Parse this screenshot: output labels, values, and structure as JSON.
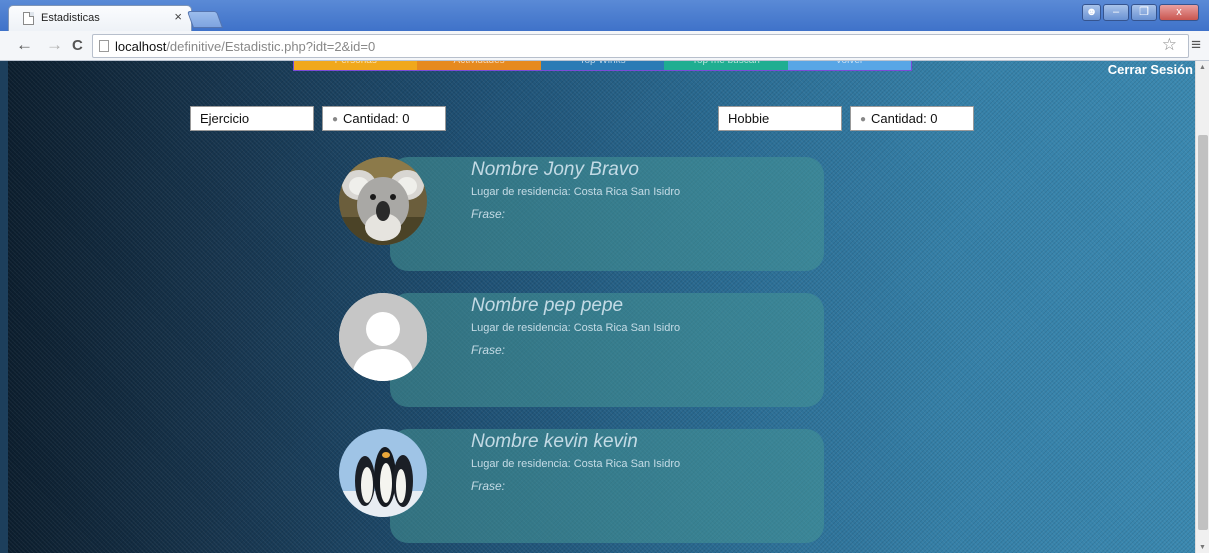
{
  "browser": {
    "tab_title": "Estadisticas",
    "tab_close": "×",
    "url_host": "localhost",
    "url_path": "/definitive/Estadistic.php?idt=2&id=0",
    "window_close": "x"
  },
  "nav": {
    "items": [
      "Personas",
      "Actividades",
      "Top Winks",
      "Top me buscan",
      "Volver"
    ],
    "logout": "Cerrar Sesión"
  },
  "stats": {
    "left_category": "Ejercicio",
    "left_count": "Cantidad: 0",
    "right_category": "Hobbie",
    "right_count": "Cantidad: 0"
  },
  "users": [
    {
      "name": "Nombre Jony Bravo",
      "residence": "Lugar de residencia: Costa Rica San Isidro",
      "phrase": "Frase:",
      "avatar": "koala"
    },
    {
      "name": "Nombre pep pepe",
      "residence": "Lugar de residencia: Costa Rica San Isidro",
      "phrase": "Frase:",
      "avatar": "default-user"
    },
    {
      "name": "Nombre kevin kevin",
      "residence": "Lugar de residencia: Costa Rica San Isidro",
      "phrase": "Frase:",
      "avatar": "penguins"
    }
  ]
}
